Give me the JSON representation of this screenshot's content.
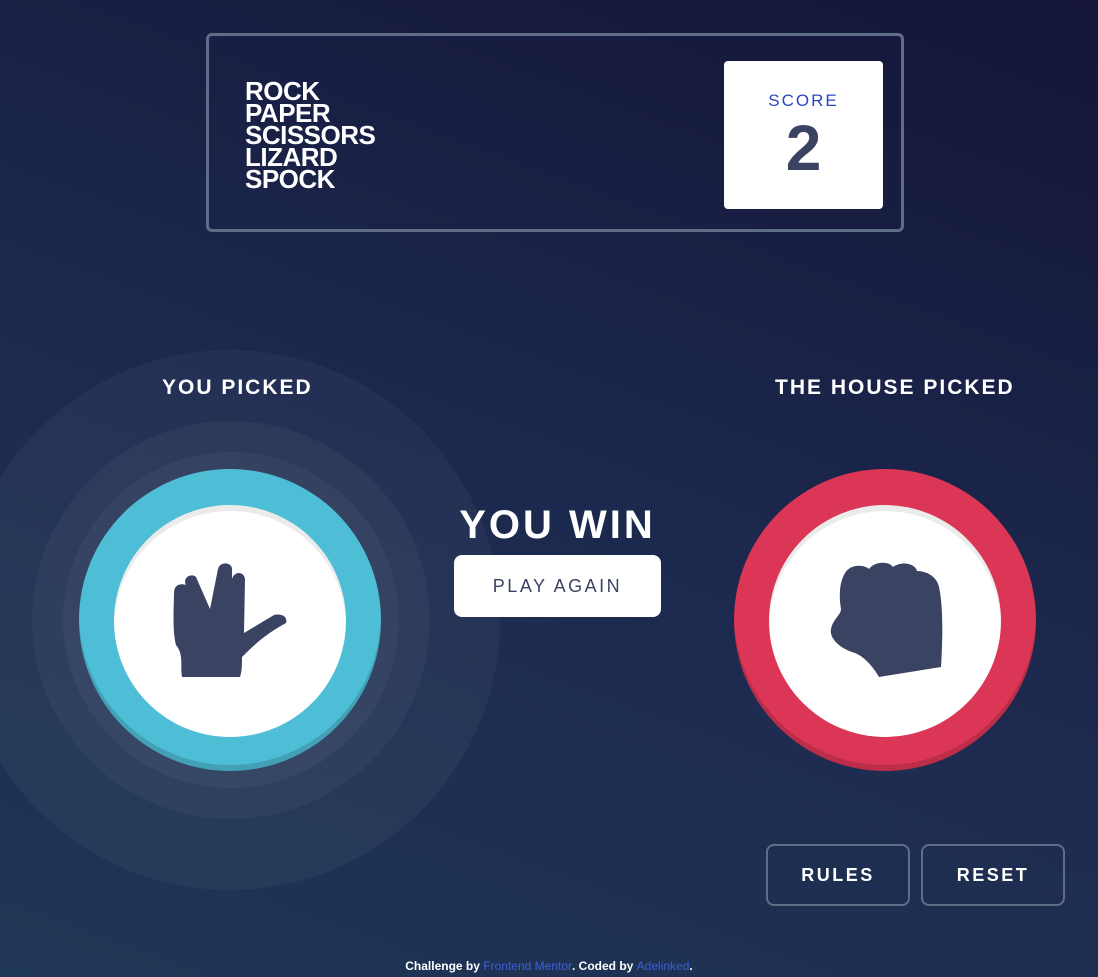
{
  "header": {
    "title_lines": [
      "ROCK",
      "PAPER",
      "SCISSORS",
      "LIZARD",
      "SPOCK"
    ],
    "score_label": "SCORE",
    "score_value": "2"
  },
  "player": {
    "label": "YOU PICKED",
    "choice": "spock",
    "icon": "spock-icon",
    "color": "#4ebed6"
  },
  "house": {
    "label": "THE HOUSE PICKED",
    "choice": "rock",
    "icon": "rock-icon",
    "color": "#dc3656"
  },
  "result": {
    "text": "YOU WIN",
    "play_again_label": "PLAY AGAIN"
  },
  "buttons": {
    "rules_label": "RULES",
    "reset_label": "RESET"
  },
  "footer": {
    "prefix": "Challenge by ",
    "link1": "Frontend Mentor",
    "middle": ". Coded by ",
    "link2": "Adelinked",
    "suffix": "."
  },
  "colors": {
    "outline": "#606e85",
    "dark_text": "#3b4363",
    "score_label": "#2a46c0",
    "link": "#3d5fd8"
  }
}
